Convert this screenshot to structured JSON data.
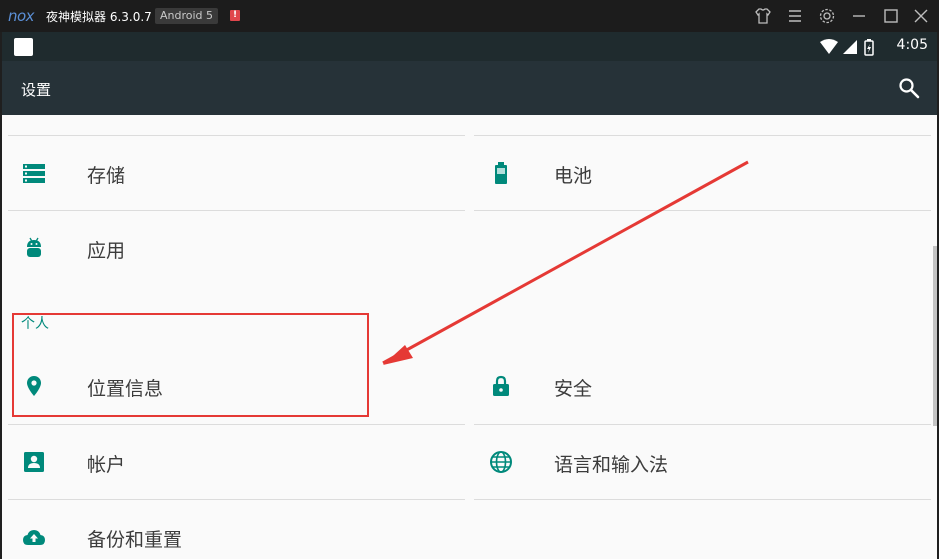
{
  "window": {
    "logo": "nox",
    "title": "夜神模拟器 6.3.0.7",
    "version_badge": "Android 5",
    "alert_badge": "!"
  },
  "window_controls": [
    "shirt-icon",
    "menu-icon",
    "gear-icon",
    "minimize-icon",
    "maximize-icon",
    "close-icon"
  ],
  "statusbar": {
    "time": "4:05"
  },
  "toolbar": {
    "title": "设置"
  },
  "settings": {
    "device": {
      "storage": "存储",
      "battery": "电池",
      "apps": "应用"
    },
    "personal_header": "个人",
    "personal": {
      "location": "位置信息",
      "security": "安全",
      "accounts": "帐户",
      "language": "语言和输入法",
      "backup": "备份和重置"
    }
  },
  "colors": {
    "accent": "#00897b",
    "toolbar": "#263238",
    "statusbar": "#1f2b2e",
    "annotation": "#e53935"
  }
}
